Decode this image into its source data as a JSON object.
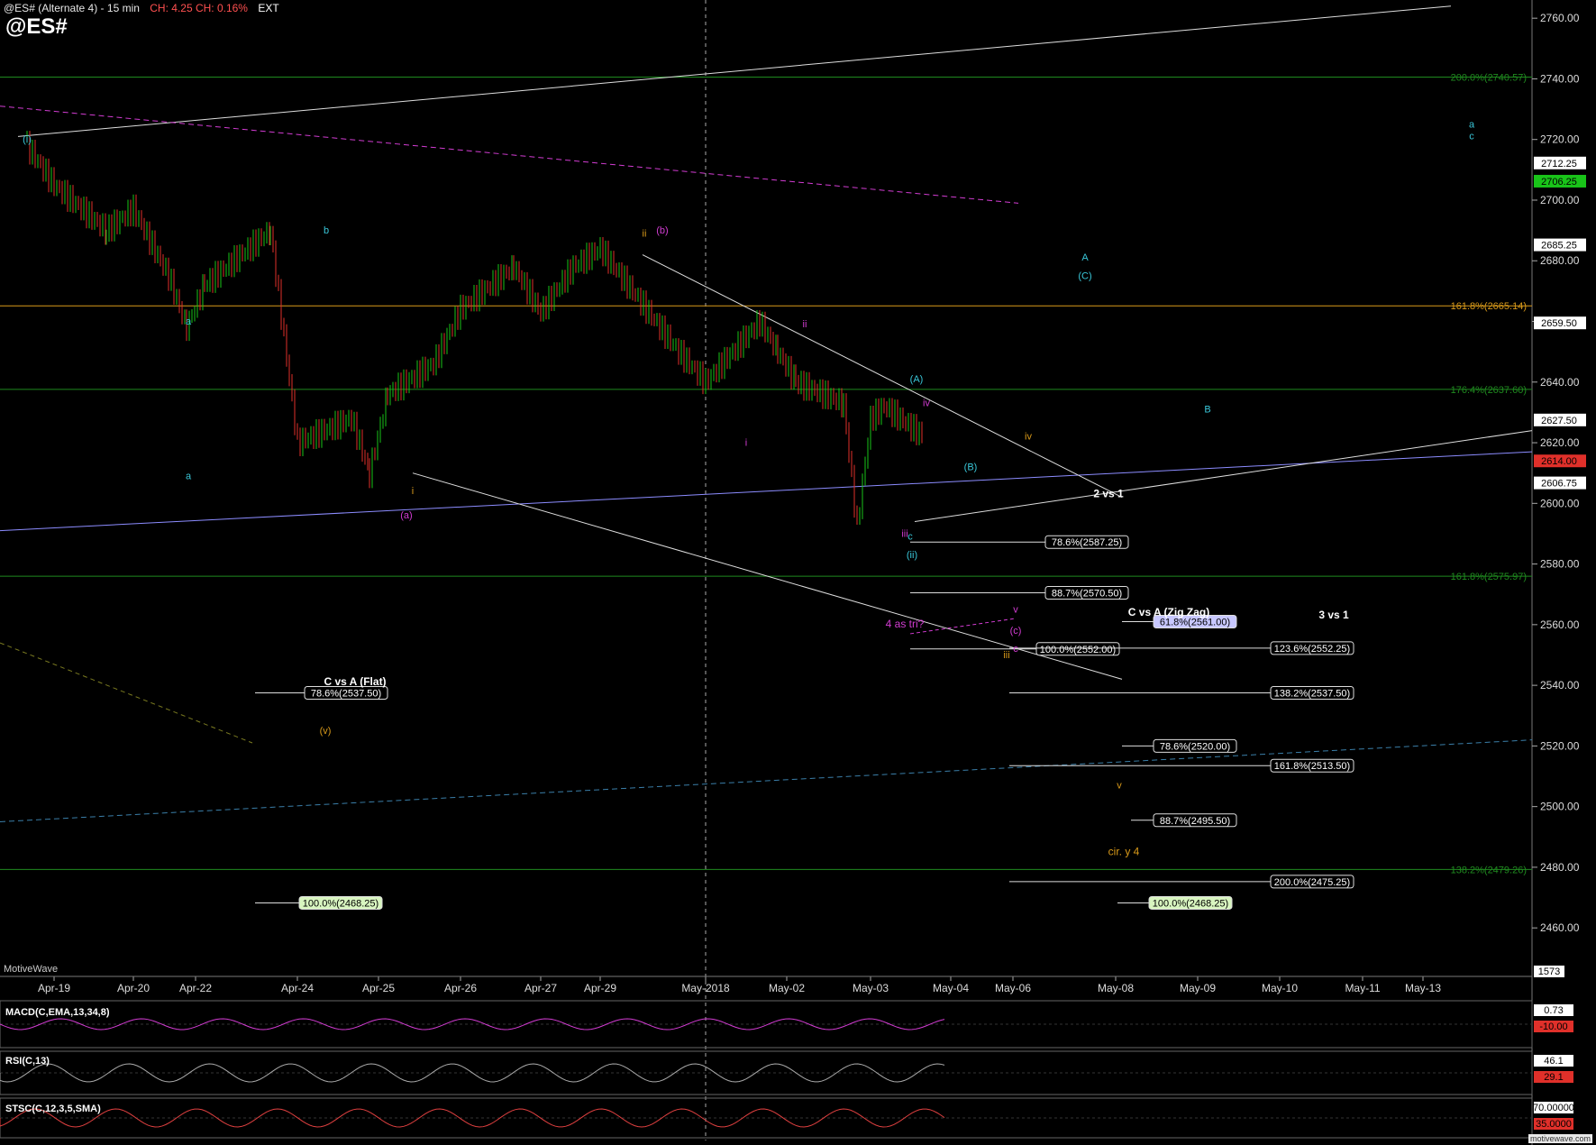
{
  "header": {
    "title": "@ES# (Alternate 4) - 15 min",
    "change": "CH: 4.25  CH: 0.16%",
    "session": "EXT",
    "symbol": "@ES#"
  },
  "watermark_text": "MotiveWave",
  "footer_mark": "motivewave.com",
  "colors": {
    "background": "#000000",
    "up_candle": "#19c419",
    "down_candle": "#e0302a",
    "fib_green": "#1f8a1f",
    "fib_orange": "#d99a1a",
    "cyan_label": "#39c6d8",
    "magenta_label": "#d23cd2",
    "yellow_arrow": "#e6e600",
    "blue_line": "#8c8cff"
  },
  "chart_data": {
    "type": "line",
    "title": "@ES# (Alternate 4) - 15 min",
    "xlabel": "",
    "ylabel": "",
    "ylim": [
      2444,
      2766
    ],
    "grid": true,
    "x_ticks": [
      "Apr-19",
      "Apr-20",
      "Apr-22",
      "Apr-24",
      "Apr-25",
      "Apr-26",
      "Apr-27",
      "Apr-29",
      "May-2018",
      "May-02",
      "May-03",
      "May-04",
      "May-06",
      "May-08",
      "May-09",
      "May-10",
      "May-11",
      "May-13"
    ],
    "y_ticks": [
      2460,
      2480,
      2500,
      2520,
      2540,
      2560,
      2580,
      2600,
      2620,
      2640,
      2660,
      2680,
      2700,
      2720,
      2740,
      2760
    ],
    "price_tags": [
      {
        "label": "2712.25",
        "color": "#ffffff",
        "value": 2712.25
      },
      {
        "label": "2706.25",
        "color": "#19c419",
        "value": 2706.25
      },
      {
        "label": "2685.25",
        "color": "#ffffff",
        "value": 2685.25
      },
      {
        "label": "2659.50",
        "color": "#ffffff",
        "value": 2659.5
      },
      {
        "label": "2627.50",
        "color": "#ffffff",
        "value": 2627.5
      },
      {
        "label": "2614.00",
        "color": "#e0302a",
        "value": 2614.0
      },
      {
        "label": "2606.75",
        "color": "#ffffff",
        "value": 2606.75
      }
    ],
    "series": [
      {
        "x": [
          "Apr-19",
          "Apr-19",
          "Apr-20",
          "Apr-20",
          "Apr-22",
          "Apr-22",
          "Apr-22",
          "Apr-24",
          "Apr-24",
          "Apr-25",
          "Apr-25",
          "Apr-25",
          "Apr-26",
          "Apr-26",
          "Apr-27",
          "Apr-27",
          "Apr-29",
          "Apr-29",
          "May-2018",
          "May-2018",
          "May-02",
          "May-02",
          "May-02",
          "May-03",
          "May-03",
          "May-03",
          "May-03",
          "May-04"
        ],
        "values": [
          2718,
          2705,
          2690,
          2697,
          2675,
          2658,
          2672,
          2690,
          2620,
          2628,
          2610,
          2636,
          2646,
          2664,
          2678,
          2663,
          2678,
          2684,
          2650,
          2640,
          2660,
          2650,
          2640,
          2633,
          2592,
          2628,
          2632,
          2622
        ]
      }
    ],
    "fib_levels_right": [
      {
        "label": "200.0%(2740.57)",
        "value": 2740.57,
        "color": "#1f8a1f"
      },
      {
        "label": "161.8%(2665.14)",
        "value": 2665.14,
        "color": "#d99a1a"
      },
      {
        "label": "176.4%(2637.60)",
        "value": 2637.6,
        "color": "#1f8a1f"
      },
      {
        "label": "161.8%(2575.97)",
        "value": 2575.97,
        "color": "#1f8a1f"
      },
      {
        "label": "138.2%(2479.26)",
        "value": 2479.26,
        "color": "#1f8a1f"
      }
    ],
    "fib_boxes": [
      {
        "label": "78.6%(2587.25)",
        "value": 2587.25,
        "style": "white"
      },
      {
        "label": "88.7%(2570.50)",
        "value": 2570.5,
        "style": "white"
      },
      {
        "label": "61.8%(2561.00)",
        "value": 2561.0,
        "style": "lavender"
      },
      {
        "label": "100.0%(2552.00)",
        "value": 2552.0,
        "style": "white"
      },
      {
        "label": "123.6%(2552.25)",
        "value": 2552.25,
        "style": "white"
      },
      {
        "label": "78.6%(2537.50)",
        "value": 2537.5,
        "style": "white"
      },
      {
        "label": "138.2%(2537.50)",
        "value": 2537.5,
        "style": "white"
      },
      {
        "label": "78.6%(2520.00)",
        "value": 2520.0,
        "style": "white"
      },
      {
        "label": "161.8%(2513.50)",
        "value": 2513.5,
        "style": "white"
      },
      {
        "label": "88.7%(2495.50)",
        "value": 2495.5,
        "style": "white"
      },
      {
        "label": "200.0%(2475.25)",
        "value": 2475.25,
        "style": "white"
      },
      {
        "label": "100.0%(2468.25)",
        "value": 2468.25,
        "style": "green"
      },
      {
        "label": "100.0%(2468.25)",
        "value": 2468.25,
        "style": "green"
      }
    ],
    "annotations": [
      {
        "text": "2 vs 1",
        "color": "#ffffff"
      },
      {
        "text": "C vs A (Zig Zag)",
        "color": "#ffffff"
      },
      {
        "text": "3 vs 1",
        "color": "#ffffff"
      },
      {
        "text": "C vs A (Flat)",
        "color": "#ffffff"
      },
      {
        "text": "4 as tri?",
        "color": "#d23cd2"
      },
      {
        "text": "cir. y 4",
        "color": "#d99a1a"
      }
    ],
    "wave_labels": [
      "(i)",
      "a",
      "b",
      "a",
      "ii",
      "(b)",
      "(a)",
      "i",
      "ii",
      "i",
      "iii",
      "c",
      "(ii)",
      "(A)",
      "iv",
      "(B)",
      "iv",
      "A",
      "(C)",
      "B",
      "a",
      "c",
      "v",
      "(c)",
      "iii",
      "c",
      "v",
      "(v)"
    ],
    "indicators": [
      {
        "name": "MACD(C,EMA,13,34,8)",
        "values_shown": [
          "0.73",
          "-10.00"
        ]
      },
      {
        "name": "RSI(C,13)",
        "values_shown": [
          "46.1",
          "29.1"
        ]
      },
      {
        "name": "STSC(C,12,3,5,SMA)",
        "values_shown": [
          "70.00000",
          "35.0000"
        ]
      }
    ],
    "volume_label": "1573"
  }
}
